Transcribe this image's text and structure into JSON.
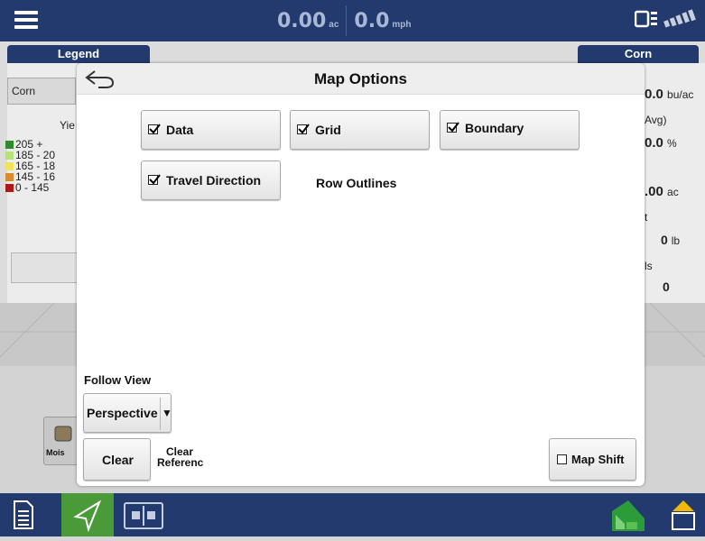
{
  "topbar": {
    "area_value": "0.00",
    "area_unit": "ac",
    "speed_value": "0.0",
    "speed_unit": "mph"
  },
  "background": {
    "legend_tab": "Legend",
    "crop_tab": "Corn",
    "crop_select": "Corn",
    "yield_label_fragment": "Yie",
    "legend_ranges": [
      {
        "label": "205 +",
        "color": "#2e8b2e"
      },
      {
        "label": "185 - 20",
        "color": "#b6e07a"
      },
      {
        "label": "165 - 18",
        "color": "#f2e25a"
      },
      {
        "label": "145 - 16",
        "color": "#d98a2c"
      },
      {
        "label": "0 - 145",
        "color": "#b01818"
      }
    ],
    "right_values": [
      {
        "value": "0.0",
        "unit": "bu/ac"
      },
      {
        "label": "Avg)",
        "value": "0.0",
        "unit": "%"
      },
      {
        "value": ".00",
        "unit": "ac"
      },
      {
        "label": "t",
        "value": "0",
        "unit": "lb"
      },
      {
        "label": "ls",
        "value": "0",
        "unit": ""
      }
    ],
    "moisture_label": "Mois"
  },
  "dialog": {
    "title": "Map Options",
    "options": {
      "data": {
        "label": "Data",
        "checked": true
      },
      "grid": {
        "label": "Grid",
        "checked": true
      },
      "boundary": {
        "label": "Boundary",
        "checked": true
      },
      "travel_direction": {
        "label": "Travel Direction",
        "checked": true
      }
    },
    "row_outlines_label": "Row Outlines",
    "follow_view_label": "Follow View",
    "perspective_value": "Perspective",
    "clear_label": "Clear",
    "clear_reference_line1": "Clear",
    "clear_reference_line2": "Referenc",
    "map_shift_label": "Map Shift",
    "map_shift_checked": false
  },
  "colors": {
    "navy": "#233a6e",
    "active_green": "#4a9a3a",
    "field_green": "#2c9b3a",
    "warning_yellow": "#f0b800"
  }
}
